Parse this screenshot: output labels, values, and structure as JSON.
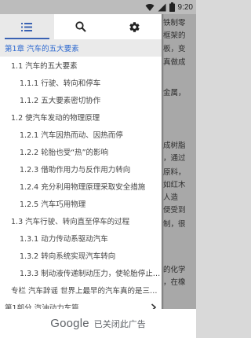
{
  "status_bar": {
    "time": "9:20",
    "icons": [
      "wifi-icon",
      "signal-icon",
      "battery-icon"
    ]
  },
  "toolbar": {
    "tabs": [
      {
        "name": "contents-list-icon",
        "active": true
      },
      {
        "name": "search-icon",
        "active": false
      },
      {
        "name": "settings-gear-icon",
        "active": false
      }
    ]
  },
  "toc": {
    "items": [
      {
        "label": "第1章 汽车的五大要素",
        "level": 0,
        "current": true
      },
      {
        "label": "1.1 汽车的五大要素",
        "level": 1,
        "current": false
      },
      {
        "label": "1.1.1 行驶、转向和停车",
        "level": 2,
        "current": false
      },
      {
        "label": "1.1.2 五大要素密切协作",
        "level": 2,
        "current": false
      },
      {
        "label": "1.2 使汽车发动的物理原理",
        "level": 1,
        "current": false
      },
      {
        "label": "1.2.1 汽车因热而动、因热而停",
        "level": 2,
        "current": false
      },
      {
        "label": "1.2.2 轮胎也受“热”的影响",
        "level": 2,
        "current": false
      },
      {
        "label": "1.2.3 借助作用力与反作用力转向",
        "level": 2,
        "current": false
      },
      {
        "label": "1.2.4 充分利用物理原理采取安全措施",
        "level": 2,
        "current": false
      },
      {
        "label": "1.2.5 汽车巧用物理",
        "level": 2,
        "current": false
      },
      {
        "label": "1.3 汽车行驶、转向直至停车的过程",
        "level": 1,
        "current": false
      },
      {
        "label": "1.3.1 动力传动系驱动汽车",
        "level": 2,
        "current": false
      },
      {
        "label": "1.3.2 转向系统实现汽车转向",
        "level": 2,
        "current": false
      },
      {
        "label": "1.3.3 制动液传递制动压力，使轮胎停止转动",
        "level": 2,
        "current": false
      },
      {
        "label": "专栏 汽车辞谣 世界上最早的汽车真的是三轮车吗？",
        "level": 1,
        "current": false
      },
      {
        "label": "第1部分 汽油动力车篇",
        "level": 0,
        "current": false,
        "has_chevron": true
      }
    ]
  },
  "reader_text": [
    "铁制零",
    "框架的",
    "板，变",
    "真做成",
    "",
    "金属，",
    "",
    "",
    "成树脂",
    "，通过",
    "原料，",
    "如红木",
    "人造",
    "便受到",
    "制，很",
    "",
    "的化学",
    "，在橡"
  ],
  "ad": {
    "logo": "Google",
    "text": "已关闭此广告"
  }
}
